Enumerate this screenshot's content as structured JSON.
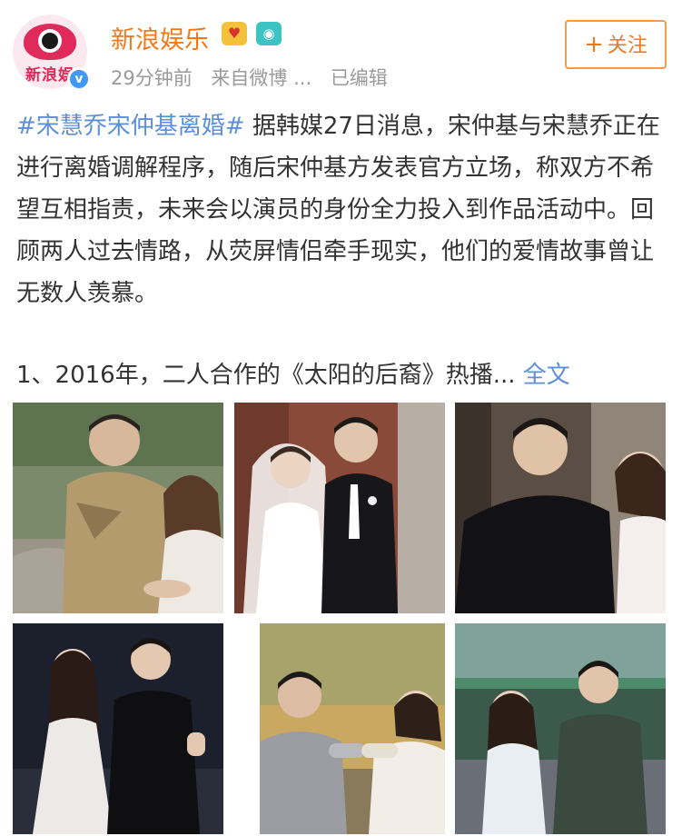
{
  "account": {
    "name": "新浪娱乐",
    "avatar_text": "新浪娱",
    "verified_mark": "v",
    "badge_icons": [
      "heart-badge-icon",
      "camera-badge-icon"
    ],
    "time": "29分钟前",
    "source": "来自微博 ...",
    "edited": "已编辑"
  },
  "follow_button": {
    "plus": "+",
    "label": "关注"
  },
  "post": {
    "hashtag": "#宋慧乔宋仲基离婚#",
    "body": " 据韩媒27日消息，宋仲基与宋慧乔正在进行离婚调解程序，随后宋仲基方发表官方立场，称双方不希望互相指责，未来会以演员的身份全力投入到作品活动中。回顾两人过去情路，从荧屏情侣牵手现实，他们的爱情故事曾让无数人羡慕。",
    "second_line": "1、2016年，二人合作的《太阳的后裔》热播...",
    "full_text_link": "全文"
  },
  "colors": {
    "username": "#f07a1a",
    "link": "#5b8fd8",
    "meta": "#9a9a9a",
    "follow_border": "#f39c4b"
  }
}
